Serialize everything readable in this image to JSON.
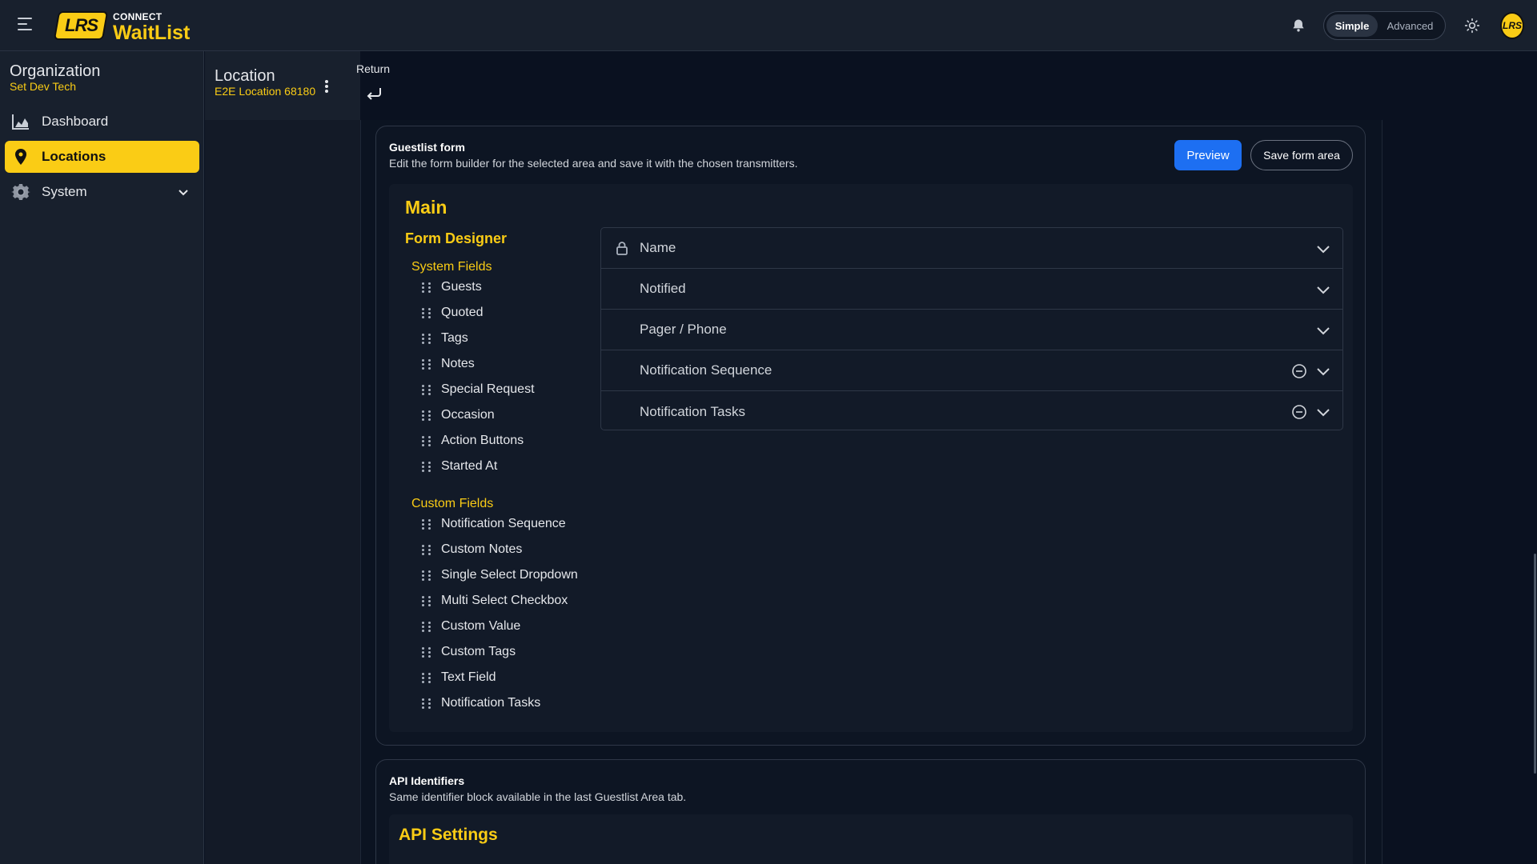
{
  "header": {
    "brand_top": "CONNECT",
    "brand_main": "WaitList",
    "logo_text": "LRS",
    "mode_simple": "Simple",
    "mode_advanced": "Advanced",
    "avatar_text": "LRS",
    "accent_color": "#facc15"
  },
  "sidebar": {
    "org_label": "Organization",
    "org_value": "Set Dev Tech",
    "items": [
      {
        "label": "Dashboard",
        "icon": "chart-area-icon"
      },
      {
        "label": "Locations",
        "icon": "map-pin-icon",
        "active": true
      },
      {
        "label": "System",
        "icon": "gear-icon"
      }
    ]
  },
  "location": {
    "label": "Location",
    "value": "E2E Location 68180",
    "return_label": "Return"
  },
  "guestlist_form": {
    "title": "Guestlist form",
    "subtitle": "Edit the form builder for the selected area and save it with the chosen transmitters.",
    "preview_label": "Preview",
    "save_label": "Save form area",
    "main_title": "Main",
    "designer_title": "Form Designer",
    "system_fields_title": "System Fields",
    "system_fields": [
      "Guests",
      "Quoted",
      "Tags",
      "Notes",
      "Special Request",
      "Occasion",
      "Action Buttons",
      "Started At"
    ],
    "custom_fields_title": "Custom Fields",
    "custom_fields": [
      "Notification Sequence",
      "Custom Notes",
      "Single Select Dropdown",
      "Multi Select Checkbox",
      "Custom Value",
      "Custom Tags",
      "Text Field",
      "Notification Tasks"
    ],
    "form_rows": [
      {
        "label": "Name",
        "locked": true,
        "removable": false
      },
      {
        "label": "Notified",
        "locked": false,
        "removable": false
      },
      {
        "label": "Pager / Phone",
        "locked": false,
        "removable": false
      },
      {
        "label": "Notification Sequence",
        "locked": false,
        "removable": true
      },
      {
        "label": "Notification Tasks",
        "locked": false,
        "removable": true
      }
    ]
  },
  "api": {
    "title": "API Identifiers",
    "subtitle": "Same identifier block available in the last Guestlist Area tab.",
    "settings_title": "API Settings"
  }
}
